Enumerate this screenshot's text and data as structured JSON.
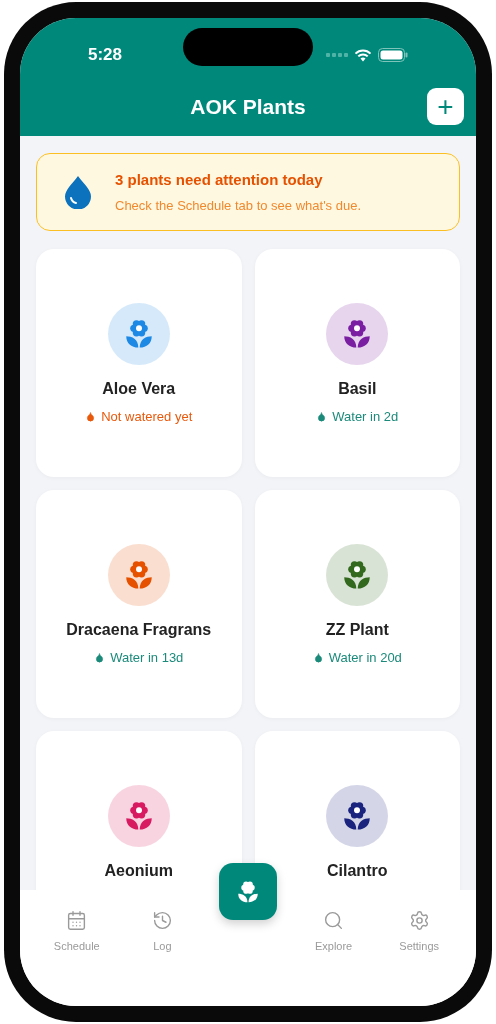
{
  "status_bar": {
    "time": "5:28"
  },
  "header": {
    "title": "AOK Plants",
    "add_button": "+"
  },
  "banner": {
    "title": "3 plants need attention today",
    "message": "Check the Schedule tab to see what's due."
  },
  "plants": [
    {
      "name": "Aloe Vera",
      "color": "#1e88e5",
      "status": {
        "kind": "due",
        "text": "Not watered yet"
      }
    },
    {
      "name": "Basil",
      "color": "#7b1fa2",
      "status": {
        "kind": "ok",
        "text": "Water in 2d"
      }
    },
    {
      "name": "Dracaena Fragrans",
      "color": "#e65100",
      "status": {
        "kind": "ok",
        "text": "Water in 13d"
      }
    },
    {
      "name": "ZZ Plant",
      "color": "#33691e",
      "status": {
        "kind": "ok",
        "text": "Water in 20d"
      }
    },
    {
      "name": "Aeonium",
      "color": "#d81b60"
    },
    {
      "name": "Cilantro",
      "color": "#1a237e"
    }
  ],
  "tab_bar": [
    {
      "kind": "schedule",
      "label": "Schedule",
      "selected": false
    },
    {
      "kind": "log",
      "label": "Log",
      "selected": false
    },
    {
      "kind": "fab"
    },
    {
      "kind": "explore",
      "label": "Explore",
      "selected": false
    },
    {
      "kind": "settings",
      "label": "Settings",
      "selected": false
    }
  ]
}
